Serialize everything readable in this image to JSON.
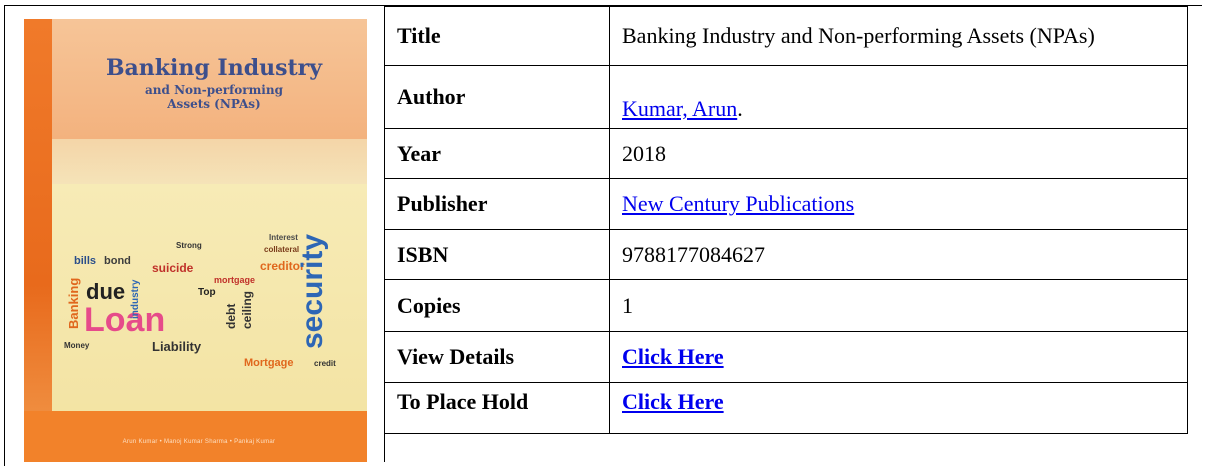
{
  "cover": {
    "title_line1": "Banking Industry",
    "title_line2": "and Non-performing",
    "title_line3": "Assets (NPAs)",
    "word_cloud": [
      "Interest",
      "collateral",
      "bills",
      "bond",
      "suicide",
      "creditor",
      "mortgage",
      "due",
      "Top",
      "Loan",
      "security",
      "debt",
      "ceiling",
      "Liability",
      "Money",
      "Mortgage",
      "credit",
      "Banking",
      "Strong",
      "industry"
    ],
    "footer_text": "Arun Kumar • Manoj Kumar Sharma • Pankaj Kumar",
    "colors": {
      "stripe": "#e86a1c",
      "title": "#3d4f8c",
      "background": "#f3e9b0"
    }
  },
  "details": {
    "title_label": "Title",
    "title_value": "Banking Industry and Non-performing Assets (NPAs)",
    "author_label": "Author",
    "author_link": "Kumar, Arun",
    "author_suffix": ".",
    "year_label": "Year",
    "year_value": "2018",
    "publisher_label": "Publisher",
    "publisher_link": "New Century Publications",
    "isbn_label": "ISBN",
    "isbn_value": "9788177084627",
    "copies_label": "Copies",
    "copies_value": "1",
    "view_label": "View Details",
    "view_link": "Click Here",
    "hold_label": "To Place Hold",
    "hold_link": "Click Here"
  }
}
